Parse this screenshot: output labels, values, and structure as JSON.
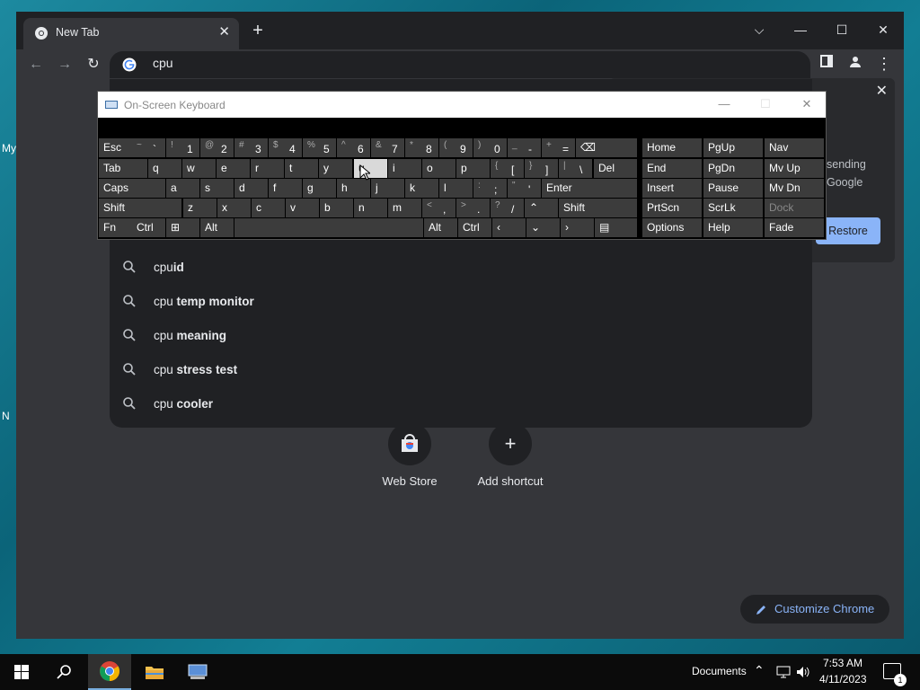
{
  "desktop": {
    "labels": [
      "My",
      "N"
    ]
  },
  "browser": {
    "tab_title": "New Tab",
    "tab_close": "✕",
    "new_tab": "+",
    "window_controls": {
      "tab_search": "⌵",
      "minimize": "—",
      "maximize": "☐",
      "close": "✕"
    },
    "omnibox_value": "cpu",
    "toolbar": {
      "back": "←",
      "forward": "→",
      "reload": "↻",
      "menu": "⋮"
    }
  },
  "suggestions": [
    {
      "prefix": "cpu",
      "bold": "id"
    },
    {
      "prefix": "cpu ",
      "bold": "temp monitor"
    },
    {
      "prefix": "cpu ",
      "bold": "meaning"
    },
    {
      "prefix": "cpu ",
      "bold": "stress test"
    },
    {
      "prefix": "cpu ",
      "bold": "cooler"
    }
  ],
  "shortcuts": [
    {
      "label": "Web Store",
      "icon": "web-store-icon"
    },
    {
      "label": "Add shortcut",
      "icon": "+"
    }
  ],
  "customize_label": "Customize Chrome",
  "restore": {
    "line1": "sending",
    "line2": "Google",
    "button": "Restore",
    "close": "✕"
  },
  "osk": {
    "title": "On-Screen Keyboard",
    "controls": {
      "minimize": "—",
      "maximize": "☐",
      "close": "✕"
    },
    "rows": [
      [
        {
          "label": "Esc"
        },
        {
          "sh": "~",
          "mn": "`"
        },
        {
          "sh": "!",
          "mn": "1"
        },
        {
          "sh": "@",
          "mn": "2"
        },
        {
          "sh": "#",
          "mn": "3"
        },
        {
          "sh": "$",
          "mn": "4"
        },
        {
          "sh": "%",
          "mn": "5"
        },
        {
          "sh": "^",
          "mn": "6"
        },
        {
          "sh": "&",
          "mn": "7"
        },
        {
          "sh": "*",
          "mn": "8"
        },
        {
          "sh": "(",
          "mn": "9"
        },
        {
          "sh": ")",
          "mn": "0"
        },
        {
          "sh": "_",
          "mn": "-"
        },
        {
          "sh": "+",
          "mn": "="
        },
        {
          "label": "⌫"
        }
      ],
      [
        {
          "label": "Tab"
        },
        {
          "label": "q"
        },
        {
          "label": "w"
        },
        {
          "label": "e"
        },
        {
          "label": "r"
        },
        {
          "label": "t"
        },
        {
          "label": "y"
        },
        {
          "label": "u",
          "highlight": true
        },
        {
          "label": "i"
        },
        {
          "label": "o"
        },
        {
          "label": "p"
        },
        {
          "sh": "{",
          "mn": "["
        },
        {
          "sh": "}",
          "mn": "]"
        },
        {
          "sh": "|",
          "mn": "\\"
        },
        {
          "label": "Del"
        }
      ],
      [
        {
          "label": "Caps"
        },
        {
          "label": "a"
        },
        {
          "label": "s"
        },
        {
          "label": "d"
        },
        {
          "label": "f"
        },
        {
          "label": "g"
        },
        {
          "label": "h"
        },
        {
          "label": "j"
        },
        {
          "label": "k"
        },
        {
          "label": "l"
        },
        {
          "sh": ":",
          "mn": ";"
        },
        {
          "sh": "\"",
          "mn": "'"
        },
        {
          "label": "Enter"
        }
      ],
      [
        {
          "label": "Shift"
        },
        {
          "label": "z"
        },
        {
          "label": "x"
        },
        {
          "label": "c"
        },
        {
          "label": "v"
        },
        {
          "label": "b"
        },
        {
          "label": "n"
        },
        {
          "label": "m"
        },
        {
          "sh": "<",
          "mn": ","
        },
        {
          "sh": ">",
          "mn": "."
        },
        {
          "sh": "?",
          "mn": "/"
        },
        {
          "label": "⌃"
        },
        {
          "label": "Shift"
        }
      ],
      [
        {
          "label": "Fn"
        },
        {
          "label": "Ctrl"
        },
        {
          "label": "⊞"
        },
        {
          "label": "Alt"
        },
        {
          "label": ""
        },
        {
          "label": "Alt"
        },
        {
          "label": "Ctrl"
        },
        {
          "label": "‹"
        },
        {
          "label": "⌄"
        },
        {
          "label": "›"
        },
        {
          "label": "▤"
        }
      ]
    ],
    "nav_keys": [
      [
        "Home",
        "PgUp",
        "Nav"
      ],
      [
        "End",
        "PgDn",
        "Mv Up"
      ],
      [
        "Insert",
        "Pause",
        "Mv Dn"
      ],
      [
        "PrtScn",
        "ScrLk",
        "Dock"
      ],
      [
        "Options",
        "Help",
        "Fade"
      ]
    ]
  },
  "taskbar": {
    "tray_label": "Documents",
    "time": "7:53 AM",
    "date": "4/11/2023",
    "notification_count": "1"
  }
}
